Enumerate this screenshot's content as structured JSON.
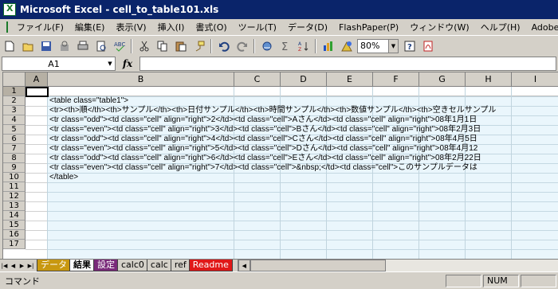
{
  "window": {
    "title": "Microsoft Excel - cell_to_table101.xls"
  },
  "menu": [
    "ファイル(F)",
    "編集(E)",
    "表示(V)",
    "挿入(I)",
    "書式(O)",
    "ツール(T)",
    "データ(D)",
    "FlashPaper(P)",
    "ウィンドウ(W)",
    "ヘルプ(H)",
    "Adobe"
  ],
  "toolbar": {
    "icons": [
      "new-icon",
      "open-icon",
      "save-icon",
      "permission-icon",
      "print-icon",
      "print-preview-icon",
      "spelling-icon",
      "cut-icon",
      "copy-icon",
      "paste-icon",
      "format-painter-icon",
      "undo-icon",
      "redo-icon",
      "hyperlink-icon",
      "autosum-icon",
      "sort-icon",
      "chart-wizard-icon",
      "drawing-icon",
      "help-icon",
      "pdf-icon"
    ],
    "zoom": "80%"
  },
  "formula_bar": {
    "name_box": "A1",
    "fx_label": "fx",
    "formula": ""
  },
  "grid": {
    "columns": [
      "A",
      "B",
      "C",
      "D",
      "E",
      "F",
      "G",
      "H",
      "I"
    ],
    "rows": [
      "1",
      "2",
      "3",
      "4",
      "5",
      "6",
      "7",
      "8",
      "9",
      "10",
      "11",
      "12",
      "13",
      "14",
      "15",
      "16",
      "17"
    ],
    "cell_text": [
      "",
      "<table class=\"table1\">",
      "<tr><th>順</th><th>サンプル</th><th>日付サンプル</th><th>時間サンプル</th><th>数値サンプル</th><th>空きセルサンプル",
      "<tr class=\"odd\"><td class=\"cell\" align=\"right\">2</td><td class=\"cell\">Aさん</td><td class=\"cell\" align=\"right\">08年1月1日",
      "<tr class=\"even\"><td class=\"cell\" align=\"right\">3</td><td class=\"cell\">Bさん</td><td class=\"cell\" align=\"right\">08年2月3日",
      "<tr class=\"odd\"><td class=\"cell\" align=\"right\">4</td><td class=\"cell\">Cさん</td><td class=\"cell\" align=\"right\">08年4月5日",
      "<tr class=\"even\"><td class=\"cell\" align=\"right\">5</td><td class=\"cell\">Dさん</td><td class=\"cell\" align=\"right\">08年4月12",
      "<tr class=\"odd\"><td class=\"cell\" align=\"right\">6</td><td class=\"cell\">Eさん</td><td class=\"cell\" align=\"right\">08年2月22日",
      "<tr class=\"even\"><td class=\"cell\" align=\"right\">7</td><td class=\"cell\">&nbsp;</td><td class=\"cell\">このサンプルデータは",
      "</table>"
    ]
  },
  "sheets": [
    {
      "label": "データ",
      "color": "#c89810",
      "active": false
    },
    {
      "label": "結果",
      "color": "",
      "active": true
    },
    {
      "label": "設定",
      "color": "#7a2a7a",
      "active": false
    },
    {
      "label": "calc0",
      "color": "",
      "active": false
    },
    {
      "label": "calc",
      "color": "",
      "active": false
    },
    {
      "label": "ref",
      "color": "",
      "active": false
    },
    {
      "label": "Readme",
      "color": "#e01818",
      "active": false
    }
  ],
  "status": {
    "text": "コマンド",
    "num": "NUM"
  }
}
